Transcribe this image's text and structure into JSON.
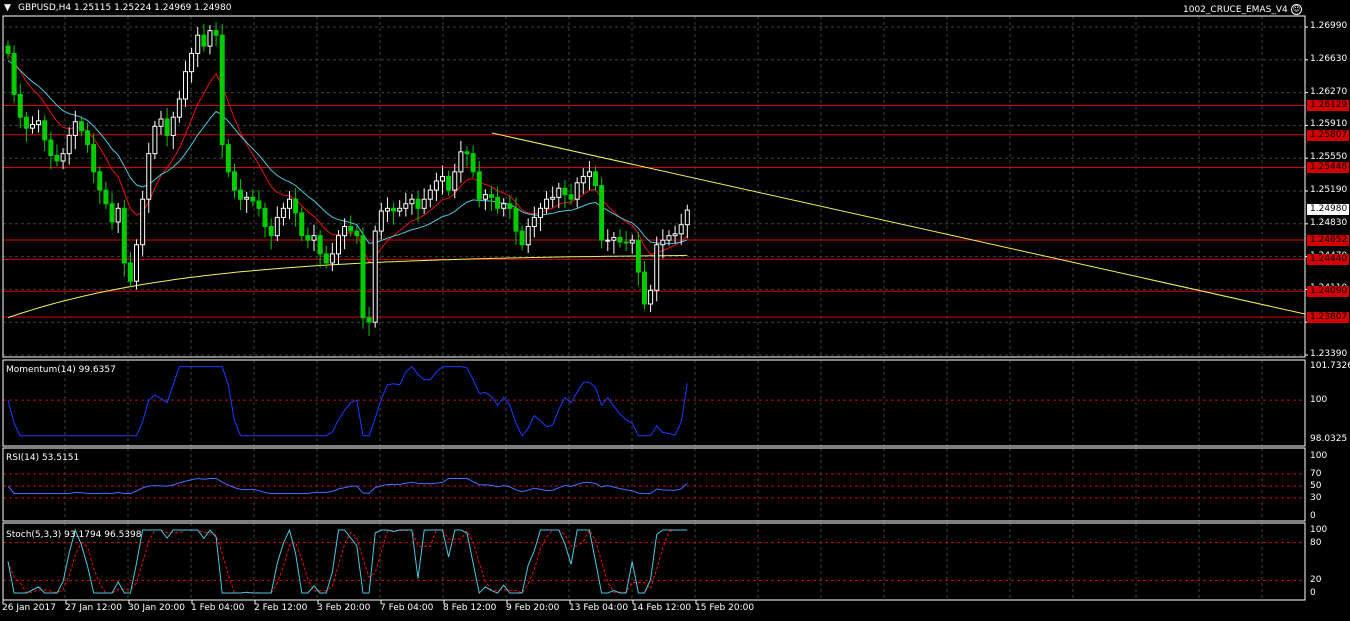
{
  "header": {
    "symbol_info": "GBPUSD,H4  1.25115 1.25224 1.24969 1.24980",
    "indicator_name": "1002_CRUCE_EMAS_V4"
  },
  "price_axis": {
    "ticks": [
      "1.26990",
      "1.26630",
      "1.26270",
      "1.25910",
      "1.25550",
      "1.25190",
      "1.24830",
      "1.24470",
      "1.24110",
      "1.23750",
      "1.23390"
    ],
    "current_price": "1.24980"
  },
  "levels": [
    {
      "label": "1.26129",
      "color": "#d40000"
    },
    {
      "label": "1.25807",
      "color": "#d40000"
    },
    {
      "label": "1.25448",
      "color": "#d40000"
    },
    {
      "label": "1.24652",
      "color": "#d40000"
    },
    {
      "label": "1.24440",
      "color": "#d40000"
    },
    {
      "label": "1.24090",
      "color": "#d40000"
    },
    {
      "label": "1.23807",
      "color": "#d40000"
    }
  ],
  "momentum": {
    "title": "Momentum(14) 99.6357",
    "ticks": [
      "101.7326",
      "100",
      "98.0325"
    ]
  },
  "rsi": {
    "title": "RSI(14) 53.5151",
    "ticks": [
      "100",
      "70",
      "50",
      "30",
      "0"
    ]
  },
  "stoch": {
    "title": "Stoch(5,3,3) 93.1794 96.5398",
    "ticks": [
      "100",
      "80",
      "20",
      "0"
    ]
  },
  "time_axis": [
    "26 Jan 2017",
    "27 Jan 12:00",
    "30 Jan 20:00",
    "1 Feb 04:00",
    "2 Feb 12:00",
    "3 Feb 20:00",
    "7 Feb 04:00",
    "8 Feb 12:00",
    "9 Feb 20:00",
    "13 Feb 04:00",
    "14 Feb 12:00",
    "15 Feb 20:00"
  ],
  "colors": {
    "background": "#000000",
    "grid": "#404040",
    "candle_up": "#ffffff",
    "candle_down": "#00cc00",
    "ema_red": "#e81010",
    "ema_cyan": "#4cc6e0",
    "ema_yellow": "#f0f060",
    "trendline": "#f0f060",
    "momentum_line": "#1a3cff",
    "rsi_line": "#3f6fff",
    "stoch_main": "#4cc6e0",
    "stoch_signal": "#e81010"
  },
  "chart_data": {
    "type": "candlestick",
    "symbol": "GBPUSD",
    "timeframe": "H4",
    "ylim": [
      1.2339,
      1.2717
    ],
    "closes": [
      1.267,
      1.2625,
      1.26,
      1.2588,
      1.2592,
      1.2596,
      1.2575,
      1.2558,
      1.2552,
      1.256,
      1.258,
      1.2595,
      1.2585,
      1.257,
      1.254,
      1.252,
      1.2505,
      1.2485,
      1.25,
      1.244,
      1.242,
      1.246,
      1.251,
      1.256,
      1.259,
      1.2598,
      1.258,
      1.26,
      1.262,
      1.265,
      1.267,
      1.269,
      1.2678,
      1.2695,
      1.269,
      1.257,
      1.254,
      1.252,
      1.251,
      1.2512,
      1.2508,
      1.25,
      1.248,
      1.247,
      1.249,
      1.25,
      1.251,
      1.2495,
      1.247,
      1.2465,
      1.247,
      1.245,
      1.244,
      1.245,
      1.247,
      1.248,
      1.2475,
      1.247,
      1.238,
      1.2375,
      1.2475,
      1.2497,
      1.25,
      1.2497,
      1.25,
      1.2505,
      1.251,
      1.25,
      1.251,
      1.252,
      1.253,
      1.2535,
      1.252,
      1.254,
      1.2562,
      1.256,
      1.254,
      1.251,
      1.2515,
      1.2512,
      1.25,
      1.2505,
      1.25,
      1.2475,
      1.246,
      1.248,
      1.249,
      1.25,
      1.251,
      1.2512,
      1.2522,
      1.2515,
      1.251,
      1.2528,
      1.2535,
      1.254,
      1.2525,
      1.2465,
      1.2465,
      1.2468,
      1.2463,
      1.2462,
      1.2465,
      1.243,
      1.2395,
      1.241,
      1.246,
      1.2465,
      1.247,
      1.2472,
      1.2482,
      1.2498
    ]
  }
}
